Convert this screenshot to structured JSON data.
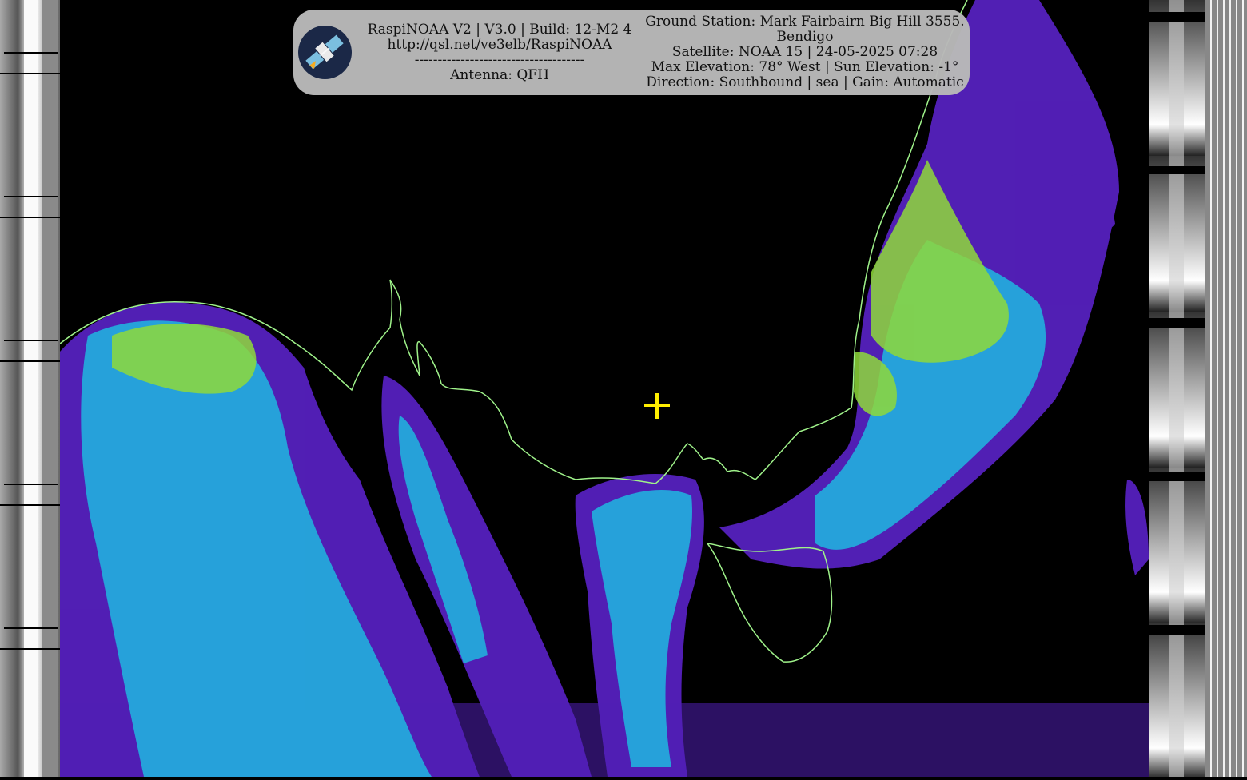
{
  "banner": {
    "left_lines": [
      "RaspiNOAA V2 | V3.0 | Build: 12-M2 4",
      "http://qsl.net/ve3elb/RaspiNOAA",
      "-------------------------------------",
      "Antenna: QFH"
    ],
    "right_lines": [
      "Ground Station: Mark Fairbairn Big Hill 3555.",
      "Bendigo",
      "Satellite: NOAA 15 | 24-05-2025 07:28",
      "Max Elevation: 78° West | Sun Elevation: -1°",
      "Direction: Southbound | sea | Gain: Automatic"
    ]
  },
  "logo_icon": "satellite-icon",
  "crosshair_icon": "crosshair-plus-icon",
  "colors": {
    "background": "#000000",
    "banner": "#b9b9b9",
    "coastline": "#9ff28a",
    "crosshair": "#ffee00",
    "cloud_low": "#6a2bd6",
    "cloud_mid": "#22c4e0",
    "cloud_high": "#9fe03a"
  }
}
